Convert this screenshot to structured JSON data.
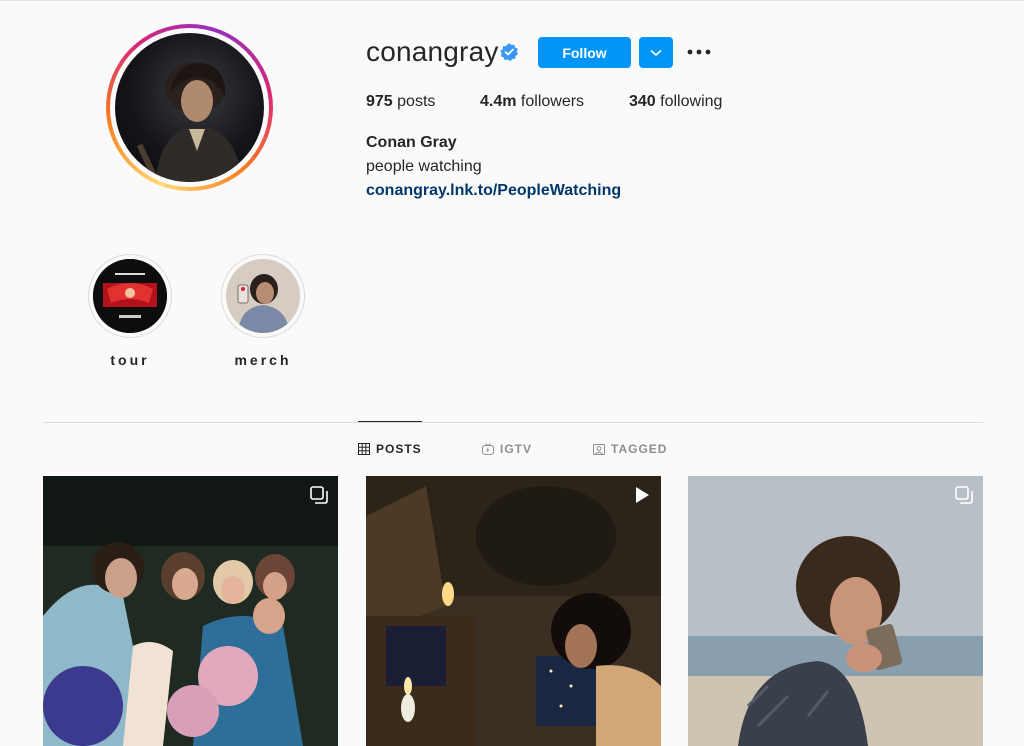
{
  "profile": {
    "username": "conangray",
    "follow_label": "Follow",
    "stats": {
      "posts_count": "975",
      "posts_label": "posts",
      "followers_count": "4.4m",
      "followers_label": "followers",
      "following_count": "340",
      "following_label": "following"
    },
    "full_name": "Conan Gray",
    "bio": "people watching",
    "link": "conangray.lnk.to/PeopleWatching"
  },
  "highlights": [
    {
      "label": "tour"
    },
    {
      "label": "merch"
    }
  ],
  "tabs": [
    {
      "label": "POSTS",
      "icon": "grid-icon",
      "active": true
    },
    {
      "label": "IGTV",
      "icon": "igtv-icon",
      "active": false
    },
    {
      "label": "TAGGED",
      "icon": "tagged-icon",
      "active": false
    }
  ],
  "posts": [
    {
      "type": "carousel",
      "badge_icon": "carousel-icon"
    },
    {
      "type": "video",
      "badge_icon": "play-icon"
    },
    {
      "type": "carousel",
      "badge_icon": "carousel-icon"
    }
  ],
  "colors": {
    "accent": "#0095f6",
    "link": "#00376b",
    "text": "#262626",
    "muted": "#8e8e8e",
    "background": "#fafafa"
  }
}
